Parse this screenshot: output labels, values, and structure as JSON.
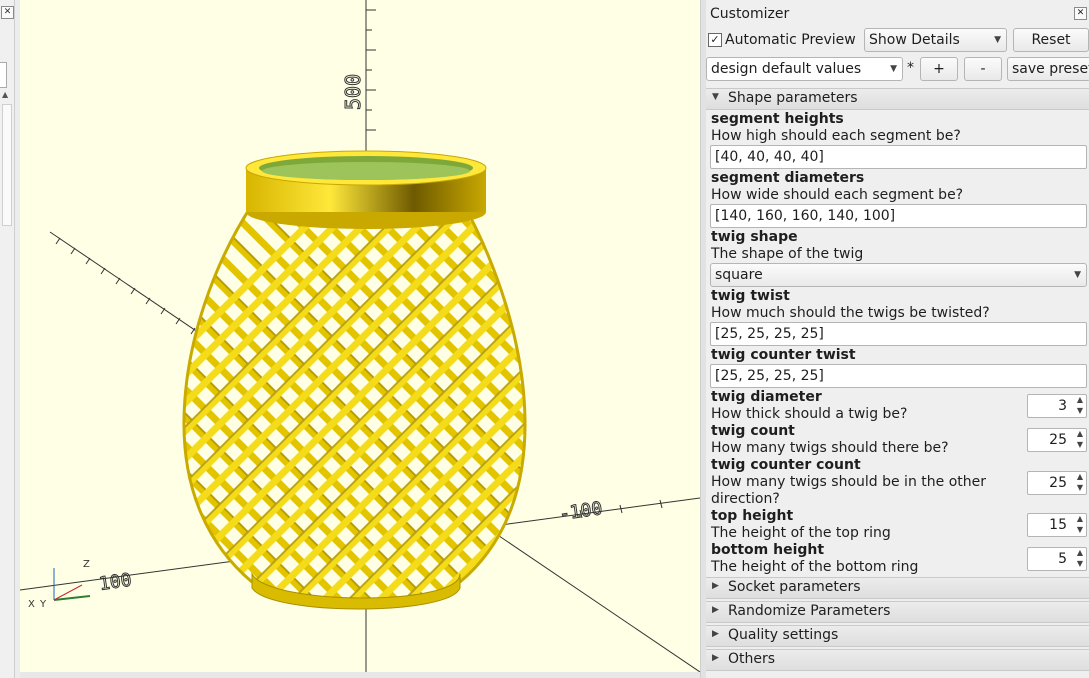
{
  "viewport": {
    "axis_labels": {
      "z_top": "500",
      "y_right": "-100",
      "x_bottom": "100",
      "z": "Z",
      "x": "X",
      "y": "Y"
    }
  },
  "customizer": {
    "title": "Customizer",
    "auto_preview_label": "Automatic Preview",
    "auto_preview_checked": "✓",
    "show_details": "Show Details",
    "reset": "Reset",
    "preset": "design default values",
    "asterisk": "*",
    "plus": "+",
    "minus": "-",
    "save_preset": "save preset",
    "sections": {
      "shape": "Shape parameters",
      "socket": "Socket parameters",
      "randomize": "Randomize Parameters",
      "quality": "Quality settings",
      "others": "Others"
    },
    "params": {
      "segment_heights": {
        "name": "segment heights",
        "desc": "How high should each segment be?",
        "value": "[40, 40, 40, 40]"
      },
      "segment_diameters": {
        "name": "segment diameters",
        "desc": "How wide should each segment be?",
        "value": "[140, 160, 160, 140, 100]"
      },
      "twig_shape": {
        "name": "twig shape",
        "desc": "The shape of the twig",
        "value": "square"
      },
      "twig_twist": {
        "name": "twig twist",
        "desc": "How much should the twigs be twisted?",
        "value": "[25, 25, 25, 25]"
      },
      "twig_counter_twist": {
        "name": "twig counter twist",
        "value": "[25, 25, 25, 25]"
      },
      "twig_diameter": {
        "name": "twig diameter",
        "desc": "How thick should a twig be?",
        "value": "3"
      },
      "twig_count": {
        "name": "twig count",
        "desc": "How many twigs should there be?",
        "value": "25"
      },
      "twig_counter_count": {
        "name": "twig counter count",
        "desc": "How many twigs should be in the other direction?",
        "value": "25"
      },
      "top_height": {
        "name": "top height",
        "desc": "The height of the top ring",
        "value": "15"
      },
      "bottom_height": {
        "name": "bottom height",
        "desc": "The height of the bottom ring",
        "value": "5"
      }
    }
  }
}
